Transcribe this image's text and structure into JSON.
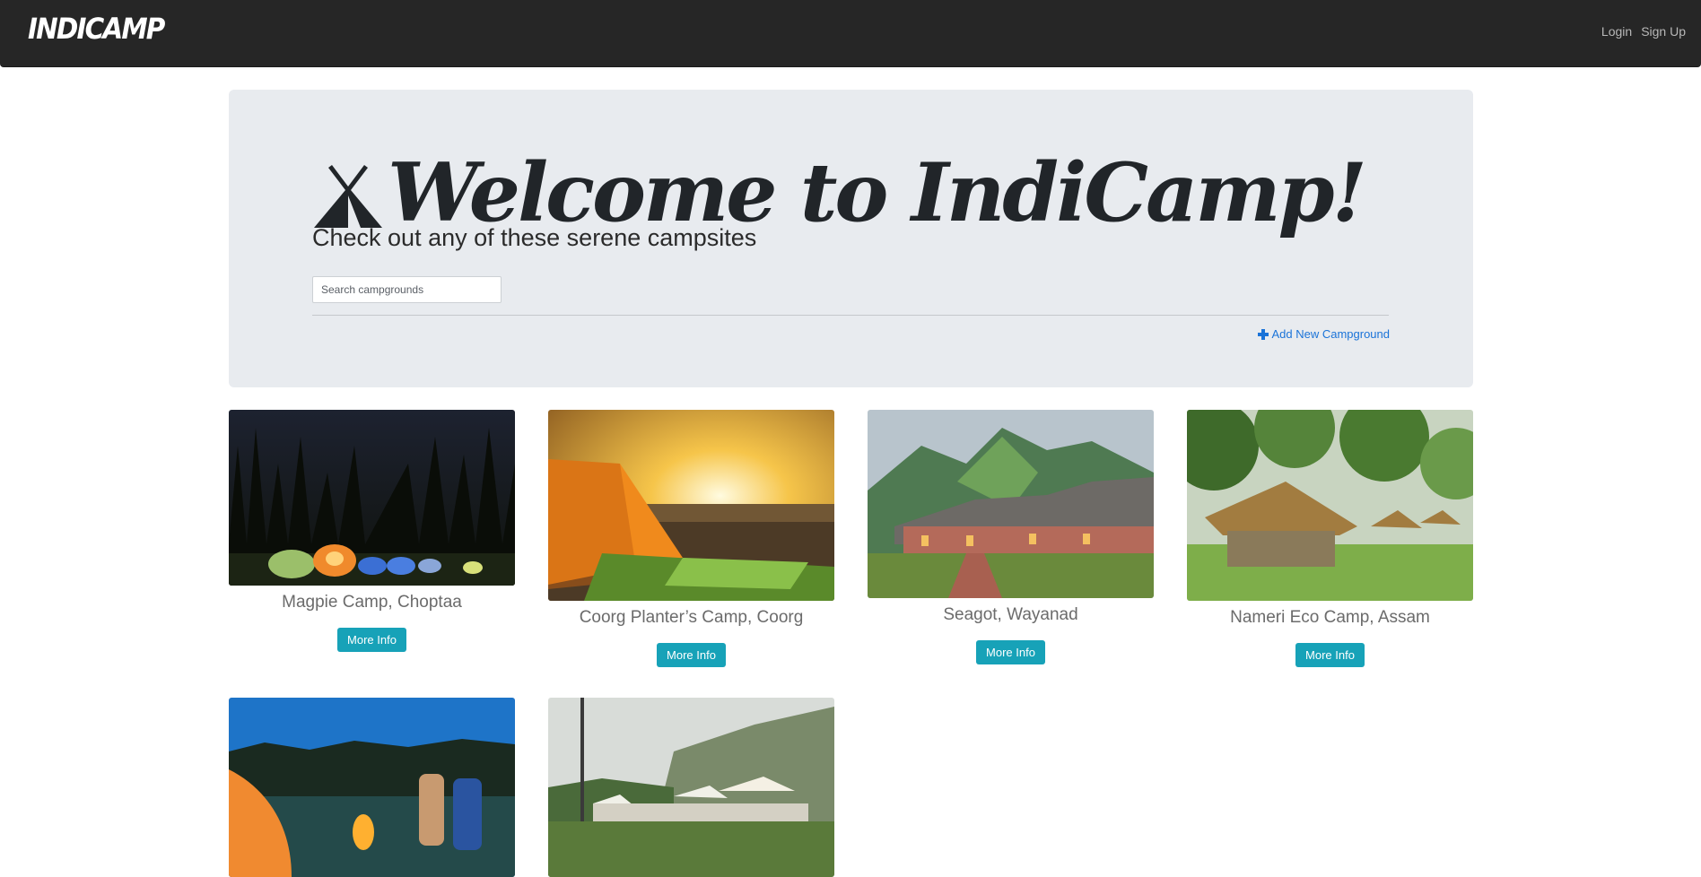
{
  "navbar": {
    "brand": "INDICAMP",
    "login": "Login",
    "signup": "Sign Up"
  },
  "hero": {
    "title": "Welcome to IndiCamp!",
    "subtitle": "Check out any of these serene campsites",
    "search_placeholder": "Search campgrounds",
    "add_link": "Add New Campground",
    "icon": "tent-icon"
  },
  "campgrounds": [
    {
      "name": "Magpie Camp, Choptaa",
      "button": "More Info",
      "image": "night-forest-tents"
    },
    {
      "name": "Coorg Planter’s Camp, Coorg",
      "button": "More Info",
      "image": "sunset-tent"
    },
    {
      "name": "Seagot, Wayanad",
      "button": "More Info",
      "image": "mountain-cottage"
    },
    {
      "name": "Nameri Eco Camp, Assam",
      "button": "More Info",
      "image": "thatched-huts"
    },
    {
      "name": "",
      "button": "",
      "image": "couple-campfire-lake"
    },
    {
      "name": "",
      "button": "",
      "image": "mountain-tents"
    }
  ],
  "colors": {
    "navbar_bg": "#262626",
    "jumbotron_bg": "#e8ebef",
    "button_bg": "#17a2b8",
    "link": "#1a73d8"
  }
}
